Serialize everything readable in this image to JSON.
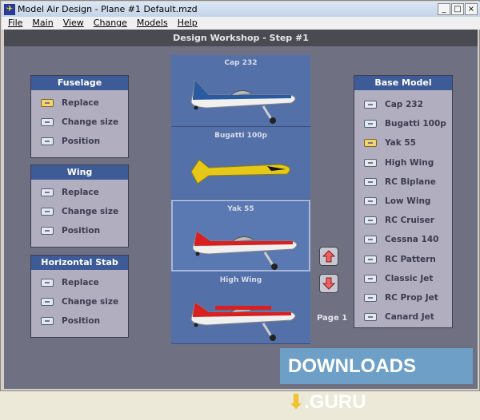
{
  "window": {
    "title": "Model Air Design - Plane #1  Default.mzd",
    "minimize": "_",
    "maximize": "□",
    "close": "×"
  },
  "menu": [
    "File",
    "Main",
    "View",
    "Change",
    "Models",
    "Help"
  ],
  "header": "Design Workshop  -  Step #1",
  "panels": [
    {
      "title": "Fuselage",
      "items": [
        {
          "label": "Replace",
          "selected": true
        },
        {
          "label": "Change size",
          "selected": false
        },
        {
          "label": "Position",
          "selected": false
        }
      ]
    },
    {
      "title": "Wing",
      "items": [
        {
          "label": "Replace",
          "selected": false
        },
        {
          "label": "Change size",
          "selected": false
        },
        {
          "label": "Position",
          "selected": false
        }
      ]
    },
    {
      "title": "Horizontal Stab",
      "items": [
        {
          "label": "Replace",
          "selected": false
        },
        {
          "label": "Change size",
          "selected": false
        },
        {
          "label": "Position",
          "selected": false
        }
      ]
    }
  ],
  "gallery": [
    {
      "name": "Cap 232",
      "color": "#2a5aa0"
    },
    {
      "name": "Bugatti 100p",
      "color": "#e6c818"
    },
    {
      "name": "Yak 55",
      "color": "#d82020",
      "selected": true
    },
    {
      "name": "High Wing",
      "color": "#d82020"
    }
  ],
  "page_label": "Page 1",
  "base_model": {
    "title": "Base Model",
    "selected": "Yak 55",
    "items": [
      "Cap 232",
      "Bugatti 100p",
      "Yak 55",
      "High Wing",
      "RC Biplane",
      "Low Wing",
      "RC Cruiser",
      "Cessna 140",
      "RC Pattern",
      "Classic Jet",
      "RC Prop Jet",
      "Canard Jet"
    ]
  },
  "watermark": "DOWNLOADS  .GURU"
}
